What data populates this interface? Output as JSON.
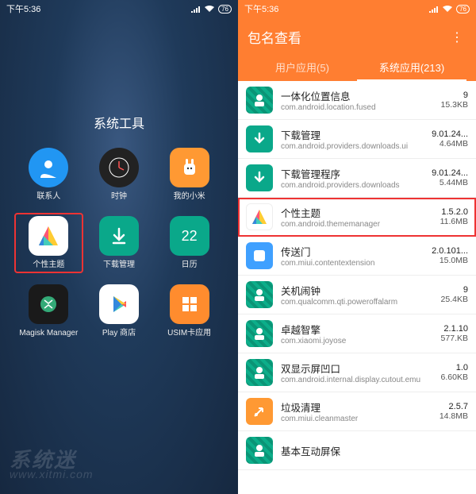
{
  "left": {
    "status": {
      "time": "下午5:36",
      "signal": "📶",
      "wifi": "📡",
      "battery": "76"
    },
    "folder_title": "系统工具",
    "apps": [
      {
        "label": "联系人",
        "icon": "contacts"
      },
      {
        "label": "时钟",
        "icon": "clock"
      },
      {
        "label": "我的小米",
        "icon": "mi"
      },
      {
        "label": "个性主题",
        "icon": "theme",
        "highlighted": true
      },
      {
        "label": "下载管理",
        "icon": "download"
      },
      {
        "label": "日历",
        "icon": "calendar",
        "badge": "22"
      },
      {
        "label": "Magisk Manager",
        "icon": "magisk"
      },
      {
        "label": "Play 商店",
        "icon": "play"
      },
      {
        "label": "USIM卡应用",
        "icon": "usim"
      }
    ],
    "watermark": {
      "main": "系统迷",
      "sub": "www.xitmi.com"
    }
  },
  "right": {
    "status": {
      "time": "下午5:36",
      "signal": "📶",
      "wifi": "📡",
      "battery": "76"
    },
    "title": "包名查看",
    "tabs": [
      {
        "label": "用户应用(5)",
        "active": false
      },
      {
        "label": "系统应用(213)",
        "active": true
      }
    ],
    "rows": [
      {
        "title": "一体化位置信息",
        "pkg": "com.android.location.fused",
        "ver": "9",
        "size": "15.3KB",
        "icon": "green"
      },
      {
        "title": "下载管理",
        "pkg": "com.android.providers.downloads.ui",
        "ver": "9.01.24...",
        "size": "4.64MB",
        "icon": "greenarrow"
      },
      {
        "title": "下载管理程序",
        "pkg": "com.android.providers.downloads",
        "ver": "9.01.24...",
        "size": "5.44MB",
        "icon": "greenarrow"
      },
      {
        "title": "个性主题",
        "pkg": "com.android.thememanager",
        "ver": "1.5.2.0",
        "size": "11.6MB",
        "icon": "theme",
        "highlighted": true
      },
      {
        "title": "传送门",
        "pkg": "com.miui.contentextension",
        "ver": "2.0.101...",
        "size": "15.0MB",
        "icon": "blue"
      },
      {
        "title": "关机闹钟",
        "pkg": "com.qualcomm.qti.poweroffalarm",
        "ver": "9",
        "size": "25.4KB",
        "icon": "green"
      },
      {
        "title": "卓越智擎",
        "pkg": "com.xiaomi.joyose",
        "ver": "2.1.10",
        "size": "577.KB",
        "icon": "green"
      },
      {
        "title": "双显示屏凹口",
        "pkg": "com.android.internal.display.cutout.emu",
        "ver": "1.0",
        "size": "6.60KB",
        "icon": "green"
      },
      {
        "title": "垃圾清理",
        "pkg": "com.miui.cleanmaster",
        "ver": "2.5.7",
        "size": "14.8MB",
        "icon": "orange"
      },
      {
        "title": "基本互动屏保",
        "pkg": "",
        "ver": "",
        "size": "",
        "icon": "green"
      }
    ]
  }
}
